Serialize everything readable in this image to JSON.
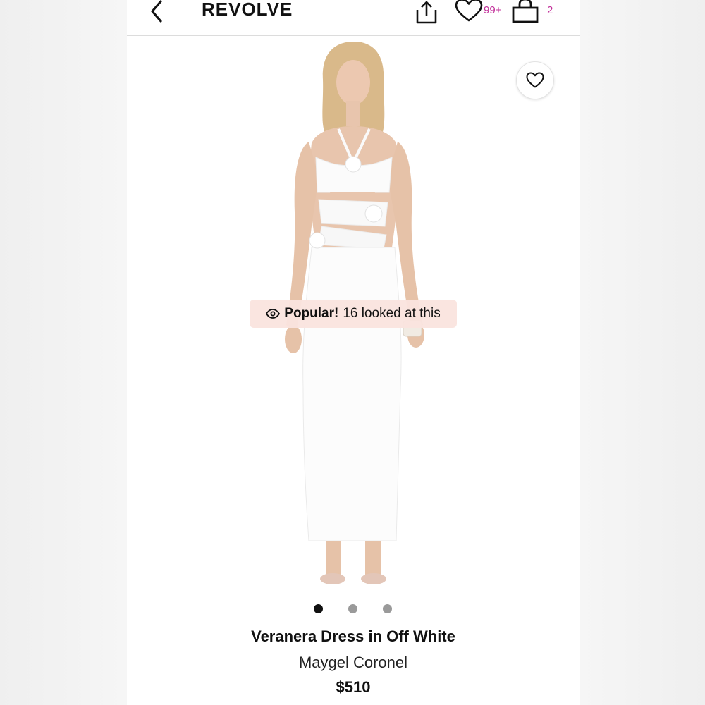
{
  "header": {
    "brand": "REVOLVE",
    "wishlist_count": "99+",
    "bag_count": "2"
  },
  "gallery": {
    "badge_label": "Popular!",
    "badge_text": "16 looked at this",
    "image_count": 3,
    "active_index": 0
  },
  "product": {
    "name": "Veranera Dress in Off White",
    "brand": "Maygel Coronel",
    "price": "$510"
  },
  "colors": {
    "accent": "#c2309a",
    "badge_bg": "#fae4de",
    "dress": "#ffffff",
    "skin": "#e8c5ad",
    "hair": "#d9b98a"
  }
}
